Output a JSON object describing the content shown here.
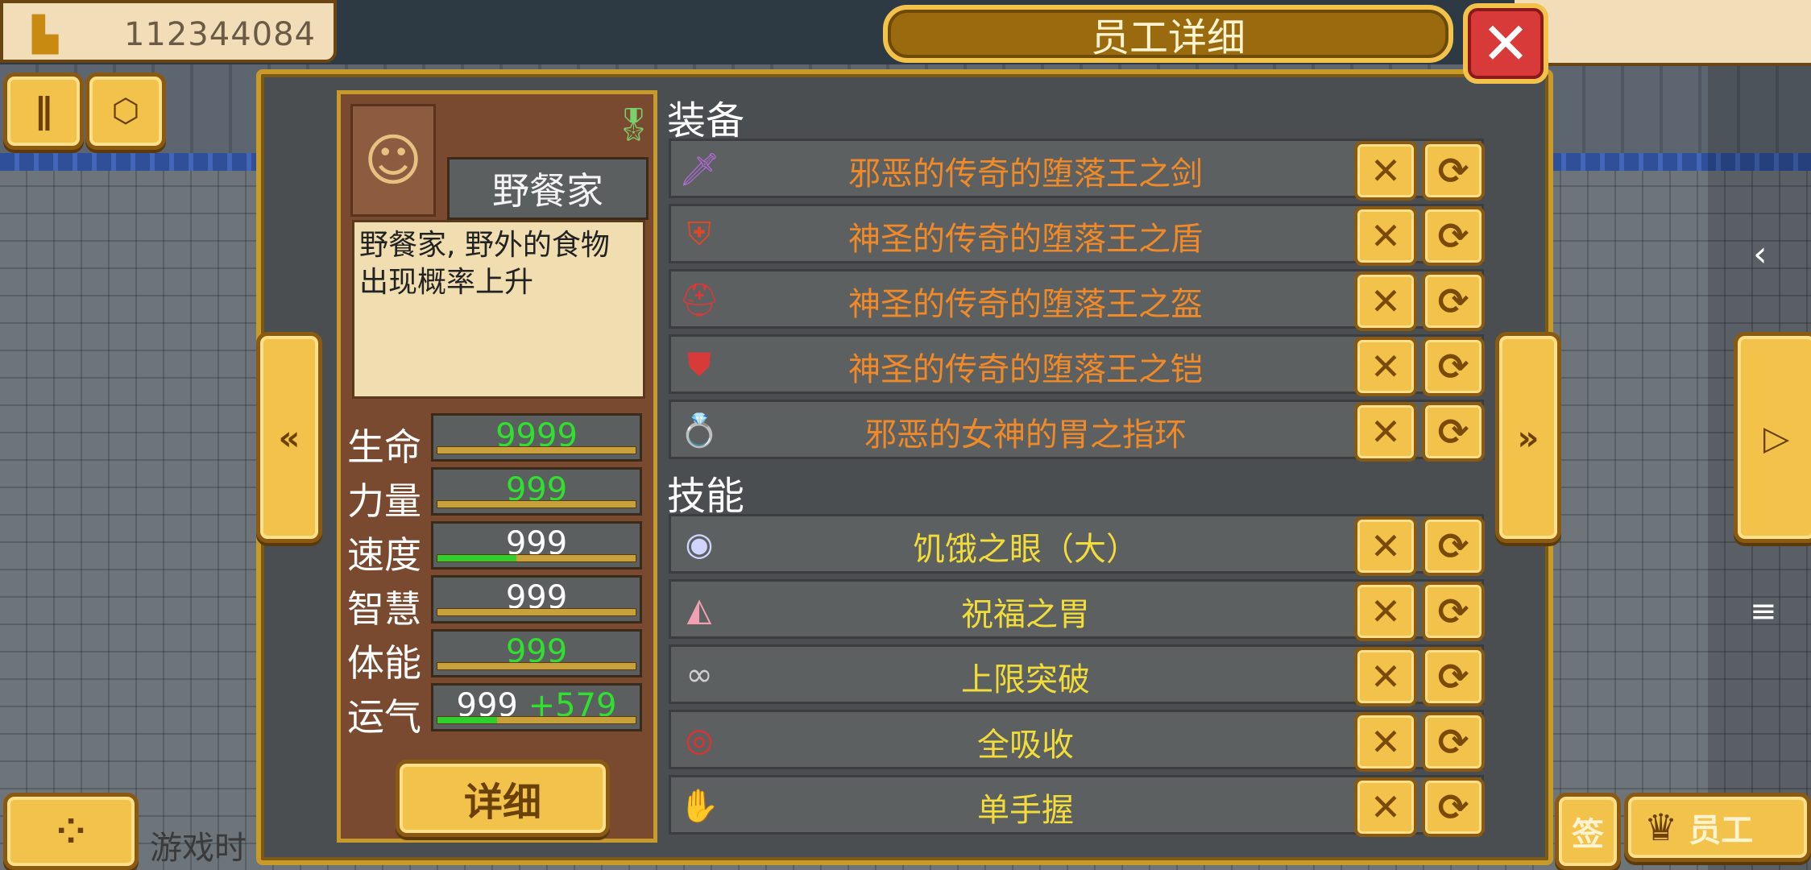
{
  "hud": {
    "money": "112344084",
    "pause_icon": "pause-icon",
    "map_icon": "map-icon",
    "bottom_left_partial": "游戏时",
    "bottom_right_partial": "签",
    "staff_button": "员工"
  },
  "dialog": {
    "title": "员工详细",
    "close_label": "✕"
  },
  "profile": {
    "name": "野餐家",
    "description": "野餐家, 野外的食物出现概率上升",
    "stats": [
      {
        "label": "生命",
        "value": "9999",
        "value_color": "#2fe02f",
        "fill": 0
      },
      {
        "label": "力量",
        "value": "999",
        "value_color": "#2fe02f",
        "fill": 0
      },
      {
        "label": "速度",
        "value": "999",
        "value_color": "#ffffff",
        "fill": 0.4
      },
      {
        "label": "智慧",
        "value": "999",
        "value_color": "#ffffff",
        "fill": 0
      },
      {
        "label": "体能",
        "value": "999",
        "value_color": "#2fe02f",
        "fill": 0
      },
      {
        "label": "运气",
        "value": "999",
        "bonus": "+579",
        "value_color": "#ffffff",
        "fill": 0.3
      }
    ],
    "detail_button": "详细"
  },
  "equipment_title": "装备",
  "equipment": [
    {
      "name": "邪恶的传奇的堕落王之剑",
      "icon": "sword-icon"
    },
    {
      "name": "神圣的传奇的堕落王之盾",
      "icon": "shield-icon"
    },
    {
      "name": "神圣的传奇的堕落王之盔",
      "icon": "helmet-icon"
    },
    {
      "name": "神圣的传奇的堕落王之铠",
      "icon": "armor-icon"
    },
    {
      "name": "邪恶的女神的胃之指环",
      "icon": "ring-icon"
    }
  ],
  "skills_title": "技能",
  "skills": [
    {
      "name": "饥饿之眼（大）",
      "icon": "eye-icon"
    },
    {
      "name": "祝福之胃",
      "icon": "pie-icon"
    },
    {
      "name": "上限突破",
      "icon": "chain-icon"
    },
    {
      "name": "全吸收",
      "icon": "absorb-icon"
    },
    {
      "name": "单手握",
      "icon": "hand-icon"
    }
  ],
  "colors": {
    "equipment_text": "#f08a28",
    "skill_text": "#f2dc3a"
  }
}
